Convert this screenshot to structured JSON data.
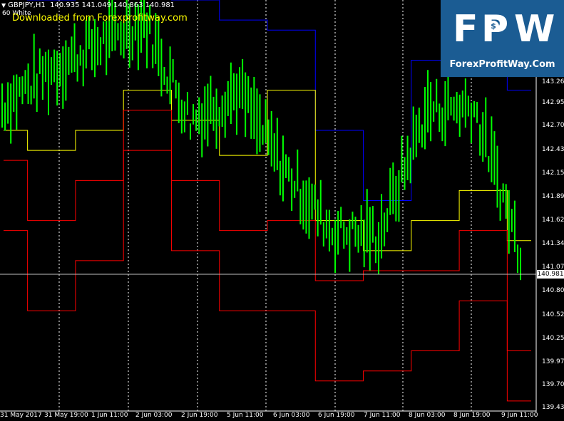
{
  "header": {
    "symbol": "GBPJPY,H1",
    "ohlc": "140.935 141.049 140.863 140.981",
    "indicator": "60 White"
  },
  "watermark": "Downloaded from Forexprofitway.com",
  "logo": {
    "letters": [
      "F",
      "P",
      "W"
    ],
    "dollar": "$",
    "url": "ForexProfitWay.Com"
  },
  "price_axis": {
    "labels": [
      "143.260",
      "142.950",
      "142.705",
      "142.430",
      "142.155",
      "141.895",
      "141.620",
      "141.345",
      "141.070",
      "140.800",
      "140.525",
      "140.250",
      "139.975",
      "139.705",
      "139.430"
    ],
    "current": "140.981"
  },
  "time_axis": {
    "labels": [
      "31 May 2017",
      "31 May 19:00",
      "1 Jun 11:00",
      "2 Jun 03:00",
      "2 Jun 19:00",
      "5 Jun 11:00",
      "6 Jun 03:00",
      "6 Jun 19:00",
      "7 Jun 11:00",
      "8 Jun 03:00",
      "8 Jun 19:00",
      "9 Jun 11:00"
    ]
  },
  "colors": {
    "candles": "#00ff00",
    "upper_band": "#0000ff",
    "mid_band": "#ffff00",
    "lower_band": "#ff0000",
    "current_line": "#c0c0c0"
  },
  "chart_data": {
    "type": "line",
    "title": "GBPJPY,H1",
    "ylim": [
      139.4,
      143.5
    ],
    "x": [
      "31 May 2017",
      "31 May 19:00",
      "1 Jun 11:00",
      "2 Jun 03:00",
      "2 Jun 19:00",
      "5 Jun 11:00",
      "6 Jun 03:00",
      "6 Jun 19:00",
      "7 Jun 11:00",
      "8 Jun 03:00",
      "8 Jun 19:00",
      "9 Jun 11:00"
    ],
    "series": [
      {
        "values": [
          142.45,
          142.8,
          143.05,
          143.3,
          142.3,
          142.6,
          141.8,
          141.2,
          141.15,
          142.4,
          142.45,
          141.0
        ]
      },
      {
        "values": [
          143.55,
          143.5,
          143.6,
          143.6,
          143.5,
          143.3,
          143.2,
          142.2,
          141.5,
          142.9,
          142.9,
          142.6
        ]
      },
      {
        "values": [
          142.2,
          142.0,
          142.2,
          142.6,
          142.3,
          141.95,
          142.6,
          141.3,
          141.0,
          141.3,
          141.6,
          141.1
        ]
      },
      {
        "values": [
          141.9,
          141.3,
          141.7,
          142.4,
          141.7,
          141.2,
          141.3,
          140.7,
          140.8,
          140.8,
          141.2,
          140.0
        ]
      },
      {
        "values": [
          141.2,
          140.4,
          140.9,
          142.0,
          141.0,
          140.4,
          140.4,
          139.7,
          139.8,
          140.0,
          140.5,
          139.5
        ]
      }
    ]
  }
}
